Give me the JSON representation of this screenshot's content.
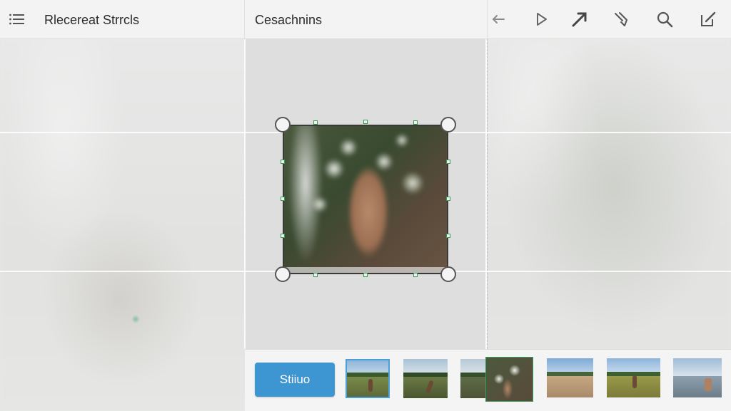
{
  "header": {
    "left_title": "Rlecereat Strrcls",
    "center_title": "Cesachnins",
    "tools": [
      {
        "name": "back-arrow-icon"
      },
      {
        "name": "play-icon"
      },
      {
        "name": "diagonal-arrow-icon"
      },
      {
        "name": "pen-tool-icon"
      },
      {
        "name": "search-icon"
      },
      {
        "name": "edit-icon"
      }
    ]
  },
  "sidebar_menu_icon": "list-menu-icon",
  "bottom_bar": {
    "primary_button_label": "Stiiuo"
  },
  "thumbnails": [
    {
      "name": "thumb-1",
      "selected": true
    },
    {
      "name": "thumb-2",
      "selected": false
    },
    {
      "name": "thumb-3",
      "selected": false
    },
    {
      "name": "thumb-4",
      "selected": false
    },
    {
      "name": "thumb-5",
      "selected": false
    },
    {
      "name": "thumb-6",
      "selected": false
    },
    {
      "name": "thumb-7",
      "selected": false
    }
  ],
  "colors": {
    "accent": "#3d95d2",
    "handle_green": "#3a9a5a",
    "background": "#e6e7e6"
  }
}
